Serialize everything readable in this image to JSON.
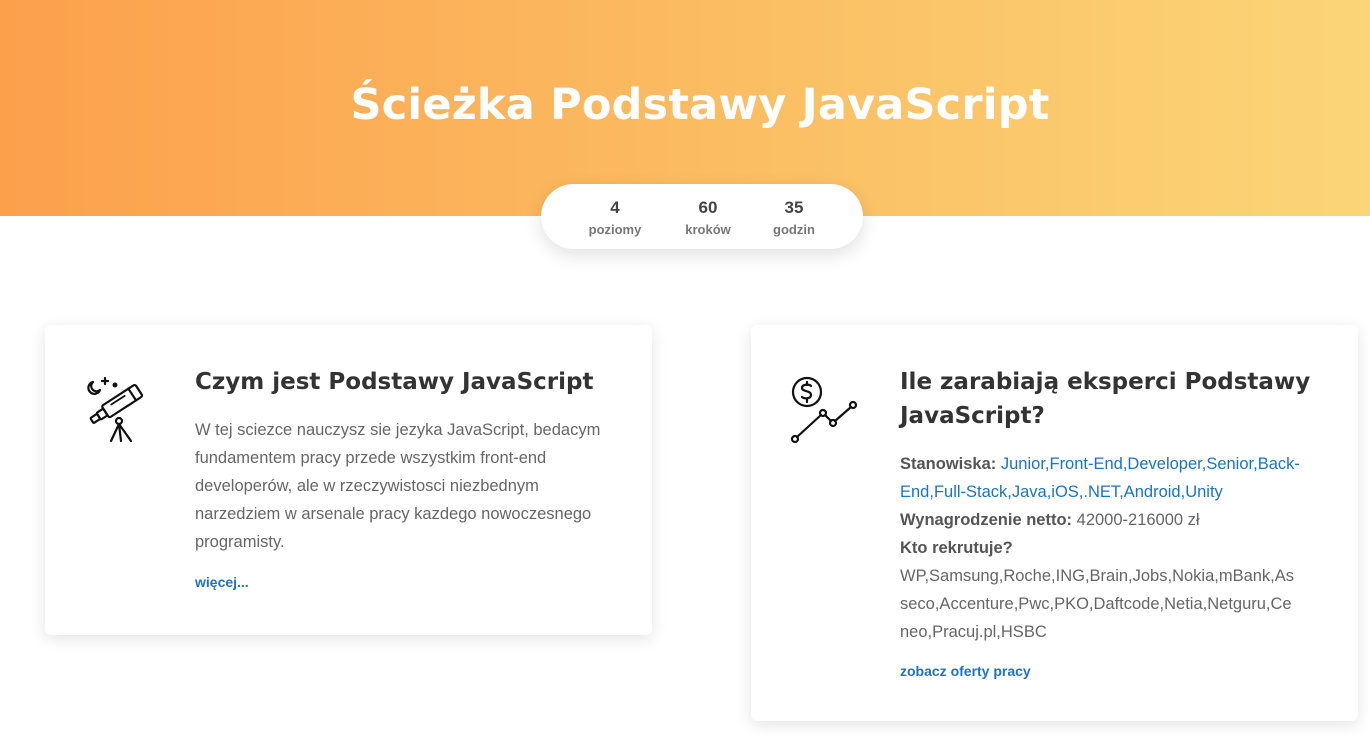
{
  "hero": {
    "title": "Ścieżka Podstawy JavaScript"
  },
  "stats": [
    {
      "value": "4",
      "label": "poziomy"
    },
    {
      "value": "60",
      "label": "kroków"
    },
    {
      "value": "35",
      "label": "godzin"
    }
  ],
  "about": {
    "title": "Czym jest Podstawy JavaScript",
    "text": "W tej sciezce nauczysz sie jezyka JavaScript, bedacym fundamentem pracy przede wszystkim front-end developerów, ale w rzeczywistosci niezbednym narzedziem w arsenale pracy kazdego nowoczesnego programisty.",
    "link": "więcej..."
  },
  "salary": {
    "title": "Ile zarabiają eksperci Podstawy JavaScript?",
    "positions_label": "Stanowiska:",
    "positions": "Junior,Front-End,Developer,Senior,Back-End,Full-Stack,Java,iOS,.NET,Android,Unity",
    "net_label": "Wynagrodzenie netto:",
    "net_value": "42000-216000 zł",
    "recruiters_label": "Kto rekrutuje?",
    "recruiters": "WP,Samsung,Roche,ING,Brain,Jobs,Nokia,mBank,Asseco,Accenture,Pwc,PKO,Daftcode,Netia,Netguru,Ceneo,Pracuj.pl,HSBC",
    "link": "zobacz oferty pracy"
  },
  "icons": {
    "about": "telescope-icon",
    "salary": "dollar-chart-icon"
  },
  "colors": {
    "accent": "#1a73c9",
    "hero_start": "#fca04c",
    "hero_end": "#fbd578"
  }
}
